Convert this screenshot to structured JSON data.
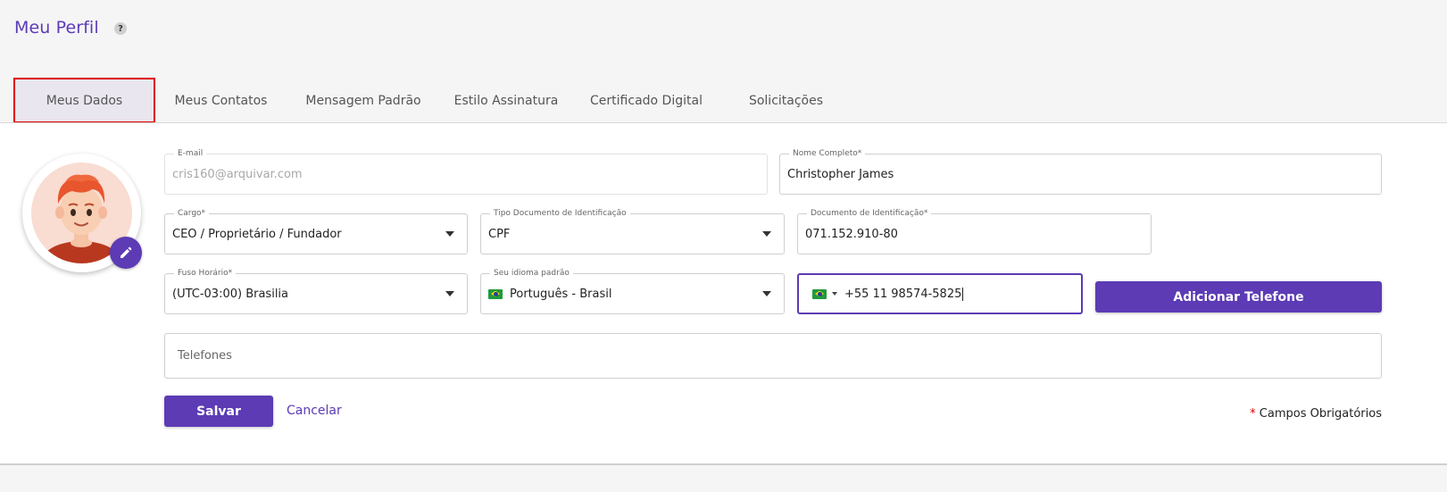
{
  "header": {
    "title": "Meu Perfil",
    "help_icon": "?"
  },
  "tabs": [
    {
      "label": "Meus Dados",
      "active": true
    },
    {
      "label": "Meus Contatos",
      "active": false
    },
    {
      "label": "Mensagem Padrão",
      "active": false
    },
    {
      "label": "Estilo Assinatura",
      "active": false
    },
    {
      "label": "Certificado Digital",
      "active": false
    },
    {
      "label": "Solicitações",
      "active": false
    }
  ],
  "form": {
    "email": {
      "label": "E-mail",
      "value": "cris160@arquivar.com"
    },
    "full_name": {
      "label": "Nome Completo*",
      "value": "Christopher James"
    },
    "cargo": {
      "label": "Cargo*",
      "value": "CEO / Proprietário / Fundador"
    },
    "doc_type": {
      "label": "Tipo Documento de Identificação",
      "value": "CPF"
    },
    "doc_number": {
      "label": "Documento de Identificação*",
      "value": "071.152.910-80"
    },
    "timezone": {
      "label": "Fuso Horário*",
      "value": "(UTC-03:00) Brasilia"
    },
    "language": {
      "label": "Seu idioma padrão",
      "value": "Português - Brasil"
    },
    "phone": {
      "value": "+55 11 98574-5825"
    },
    "phones_list": {
      "placeholder": "Telefones"
    }
  },
  "buttons": {
    "add_phone": "Adicionar Telefone",
    "save": "Salvar",
    "cancel": "Cancelar"
  },
  "required_note": {
    "star": "*",
    "text": "Campos Obrigatórios"
  },
  "colors": {
    "accent": "#5c3bb5",
    "active_tab_border": "#e00000"
  }
}
